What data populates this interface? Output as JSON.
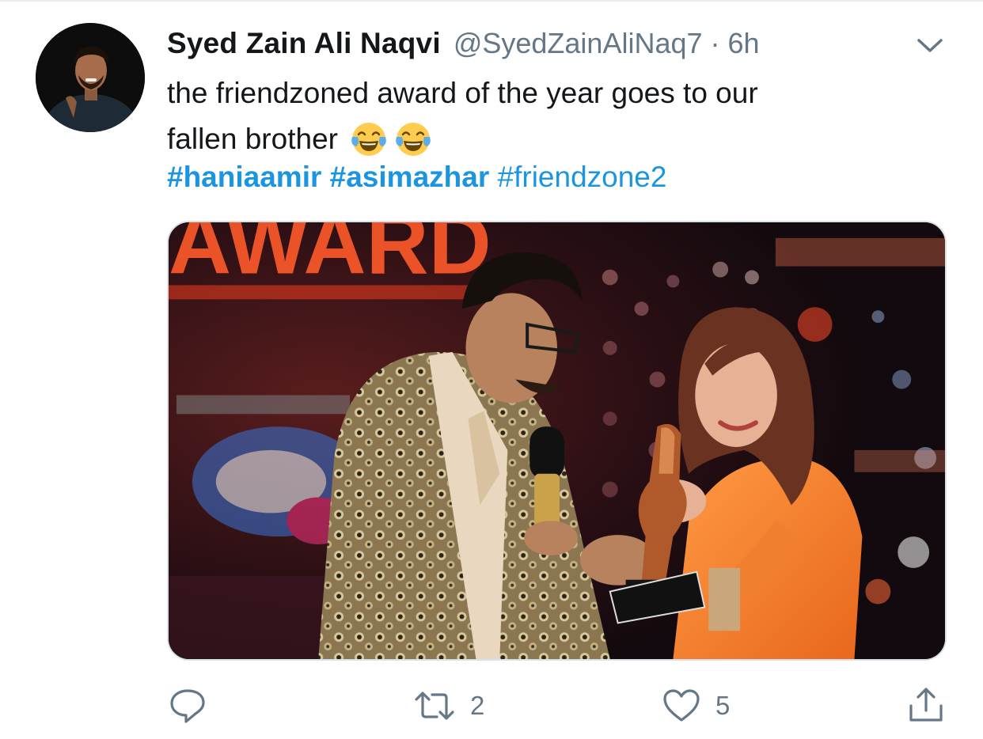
{
  "tweet": {
    "author": {
      "display_name": "Syed Zain Ali Naqvi",
      "handle": "@SyedZainAliNaq7",
      "separator": "·",
      "time": "6h"
    },
    "text_line1": "the friendzoned award of the year goes to our",
    "text_line2": "fallen brother",
    "emojis": [
      "face-with-tears-of-joy-icon",
      "face-with-tears-of-joy-icon"
    ],
    "hashtags": [
      {
        "text": "#haniaamir",
        "bold": true
      },
      {
        "text": "#asimazhar",
        "bold": true
      },
      {
        "text": "#friendzone2",
        "bold": false
      }
    ],
    "media_banner_text": "AWARD",
    "actions": {
      "reply_count": "",
      "retweet_count": "2",
      "like_count": "5"
    }
  },
  "colors": {
    "link": "#1b95e0",
    "secondary_text": "#657786",
    "primary_text": "#14171a",
    "border": "#e6ecf0"
  }
}
